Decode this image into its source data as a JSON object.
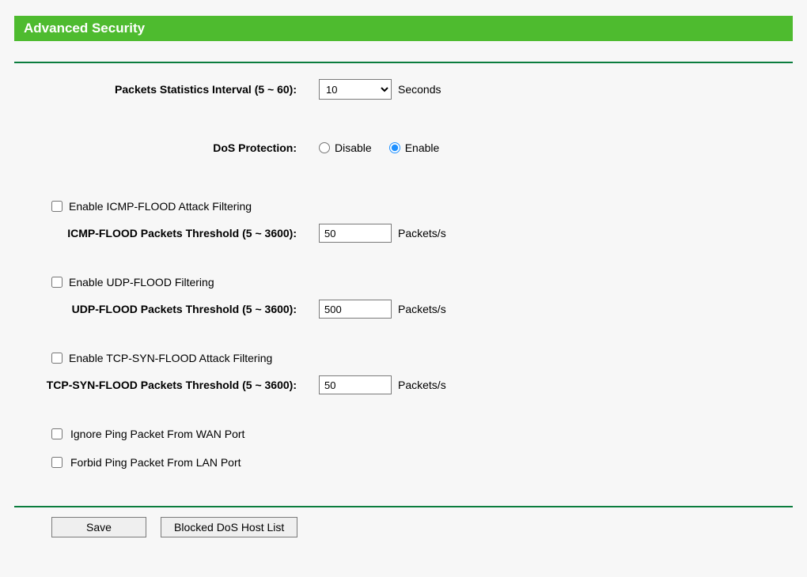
{
  "header": {
    "title": "Advanced Security"
  },
  "stats_interval": {
    "label": "Packets Statistics Interval (5 ~ 60):",
    "value": "10",
    "unit": "Seconds"
  },
  "dos_protection": {
    "label": "DoS Protection:",
    "disable_label": "Disable",
    "enable_label": "Enable",
    "selected": "enable"
  },
  "icmp": {
    "enable_label": "Enable ICMP-FLOOD Attack Filtering",
    "threshold_label": "ICMP-FLOOD Packets Threshold (5 ~ 3600):",
    "threshold_value": "50",
    "unit": "Packets/s"
  },
  "udp": {
    "enable_label": "Enable UDP-FLOOD Filtering",
    "threshold_label": "UDP-FLOOD Packets Threshold (5 ~ 3600):",
    "threshold_value": "500",
    "unit": "Packets/s"
  },
  "tcp": {
    "enable_label": "Enable TCP-SYN-FLOOD Attack Filtering",
    "threshold_label": "TCP-SYN-FLOOD Packets Threshold (5 ~ 3600):",
    "threshold_value": "50",
    "unit": "Packets/s"
  },
  "ping": {
    "wan_label": "Ignore Ping Packet From WAN Port",
    "lan_label": "Forbid Ping Packet From LAN Port"
  },
  "buttons": {
    "save": "Save",
    "blocked_list": "Blocked DoS Host List"
  }
}
